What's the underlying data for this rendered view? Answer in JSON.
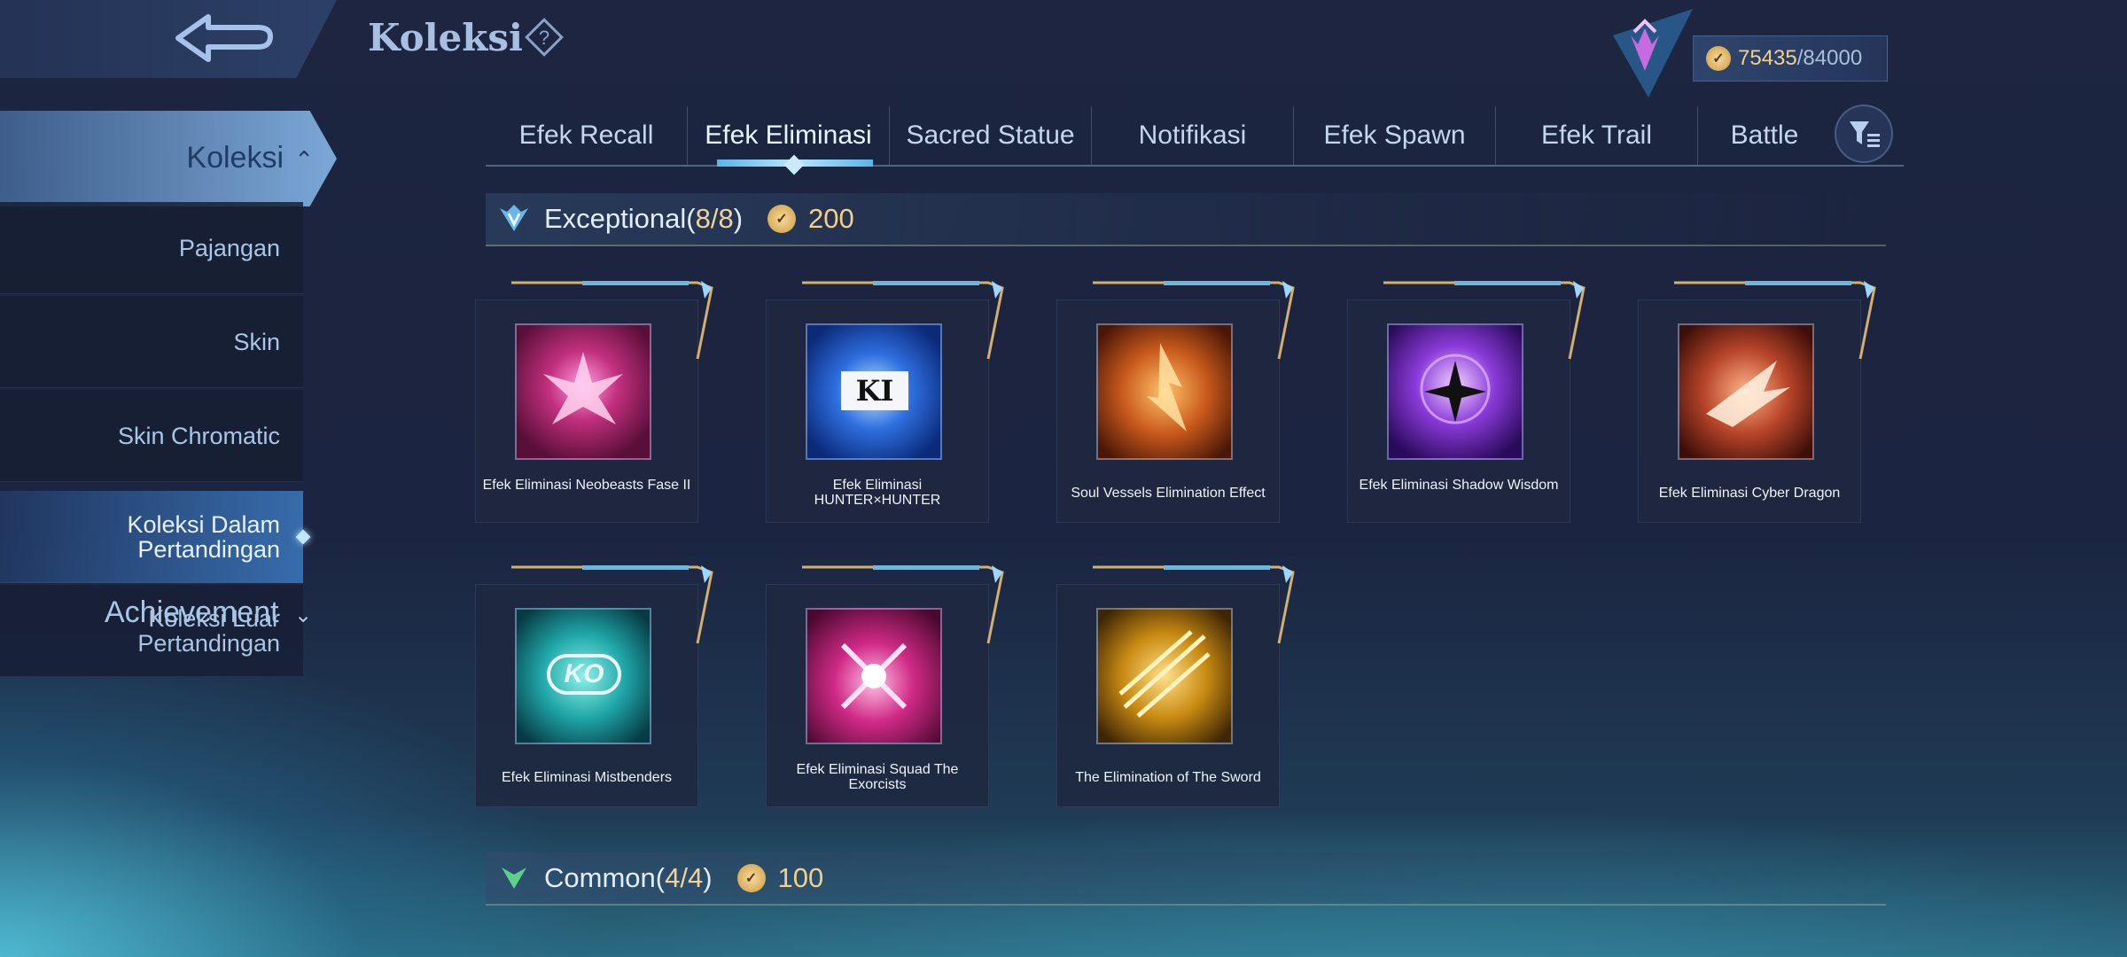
{
  "header": {
    "title": "Koleksi",
    "points_current": "75435",
    "points_sep": "/",
    "points_max": "84000"
  },
  "sidebar": {
    "main": "Koleksi",
    "items": [
      {
        "label": "Pajangan",
        "active": false
      },
      {
        "label": "Skin",
        "active": false
      },
      {
        "label": "Skin Chromatic",
        "active": false
      },
      {
        "label": "Koleksi Dalam Pertandingan",
        "active": true
      },
      {
        "label": "Koleksi Luar Pertandingan",
        "active": false
      }
    ],
    "achievement": "Achievement"
  },
  "tabs": [
    {
      "label": "Efek Recall"
    },
    {
      "label": "Efek Eliminasi"
    },
    {
      "label": "Sacred Statue"
    },
    {
      "label": "Notifikasi"
    },
    {
      "label": "Efek Spawn"
    },
    {
      "label": "Efek Trail"
    },
    {
      "label": "Battle"
    }
  ],
  "sections": {
    "exceptional": {
      "title": "Exceptional(",
      "count": "8/8",
      "close": ")",
      "points": "200"
    },
    "common": {
      "title": "Common(",
      "count": "4/4",
      "close": ")",
      "points": "100"
    }
  },
  "items": [
    {
      "name": "Efek Eliminasi Neobeasts Fase II",
      "color": "#c2307e"
    },
    {
      "name": "Efek Eliminasi HUNTER×HUNTER",
      "color": "#2f6fe0",
      "mark": "KI"
    },
    {
      "name": "Soul Vessels Elimination Effect",
      "color": "#c95a1c"
    },
    {
      "name": "Efek Eliminasi Shadow Wisdom",
      "color": "#8a3ad8"
    },
    {
      "name": "Efek Eliminasi Cyber Dragon",
      "color": "#b8452a"
    },
    {
      "name": "Efek Eliminasi Mistbenders",
      "color": "#1fa6a8",
      "mark": "KO"
    },
    {
      "name": "Efek Eliminasi Squad The Exorcists",
      "color": "#d02a86"
    },
    {
      "name": "The Elimination of The Sword",
      "color": "#c98a12"
    }
  ]
}
